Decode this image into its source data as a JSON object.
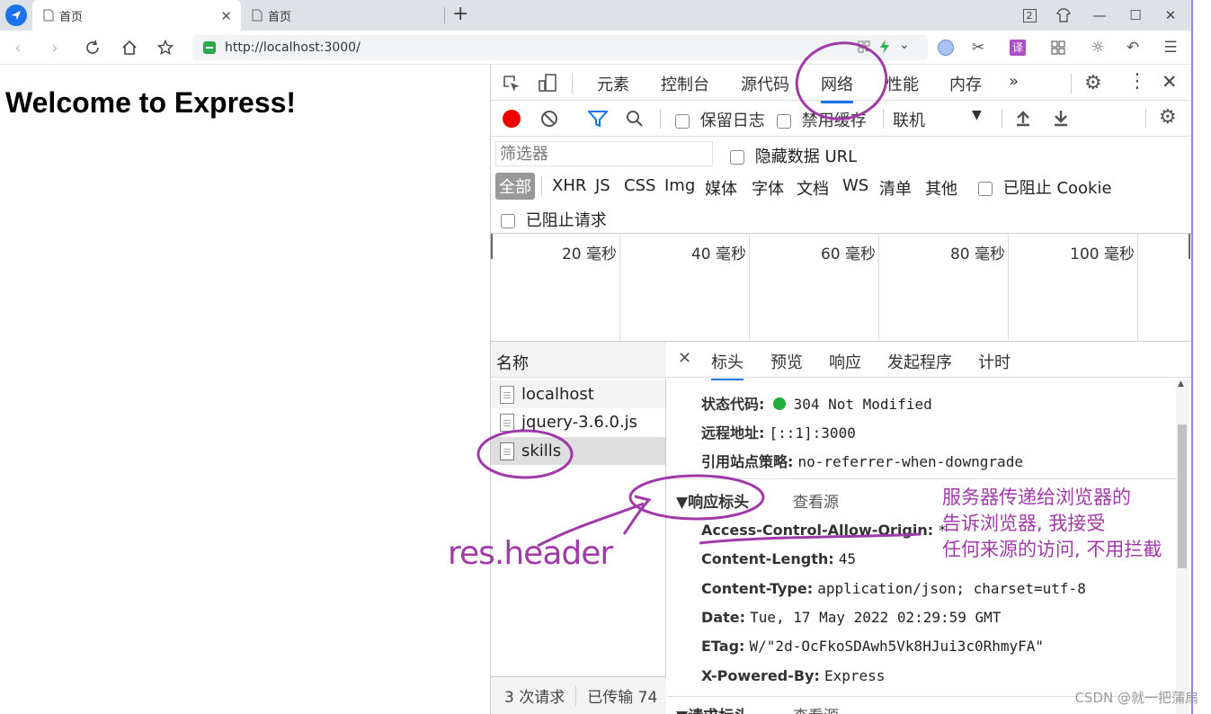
{
  "browser": {
    "tabs": [
      {
        "title": "首页",
        "active": true
      },
      {
        "title": "首页",
        "active": false
      }
    ],
    "window_badge": "2",
    "url": "http://localhost:3000/"
  },
  "page": {
    "heading": "Welcome to Express!"
  },
  "devtools": {
    "tabs": [
      "元素",
      "控制台",
      "源代码",
      "网络",
      "性能",
      "内存"
    ],
    "active_tab": "网络",
    "more_label": "»",
    "toolbar": {
      "preserve_log": "保留日志",
      "disable_cache": "禁用缓存",
      "throttle": "联机"
    },
    "filter": {
      "placeholder": "筛选器",
      "hide_data_url": "隐藏数据 URL"
    },
    "types": [
      "全部",
      "XHR",
      "JS",
      "CSS",
      "Img",
      "媒体",
      "字体",
      "文档",
      "WS",
      "清单",
      "其他"
    ],
    "blocked_cookie": "已阻止 Cookie",
    "blocked_requests": "已阻止请求",
    "timeline_labels": [
      "20 毫秒",
      "40 毫秒",
      "60 毫秒",
      "80 毫秒",
      "100 毫秒"
    ],
    "name_header": "名称",
    "requests": [
      "localhost",
      "jquery-3.6.0.js",
      "skills"
    ],
    "footer": {
      "requests": "3 次请求",
      "transferred": "已传输 74"
    },
    "detail_tabs": [
      "标头",
      "预览",
      "响应",
      "发起程序",
      "计时"
    ],
    "general": [
      {
        "key": "状态代码:",
        "value": "304 Not Modified"
      },
      {
        "key": "远程地址:",
        "value": "[::1]:3000"
      },
      {
        "key": "引用站点策略:",
        "value": "no-referrer-when-downgrade"
      }
    ],
    "response_headers_title": "▼响应标头",
    "view_source": "查看源",
    "response_headers": [
      {
        "key": "Access-Control-Allow-Origin:",
        "value": "*"
      },
      {
        "key": "Content-Length:",
        "value": "45"
      },
      {
        "key": "Content-Type:",
        "value": "application/json; charset=utf-8"
      },
      {
        "key": "Date:",
        "value": "Tue, 17 May 2022 02:29:59 GMT"
      },
      {
        "key": "ETag:",
        "value": "W/\"2d-OcFkoSDAwh5Vk8HJui3c0RhmyFA\""
      },
      {
        "key": "X-Powered-By:",
        "value": "Express"
      }
    ],
    "request_headers_title": "▼请求标头",
    "status_color": "#1fae3d",
    "accent_color": "#1a73e8"
  },
  "annotations": {
    "res_header": "res.header",
    "note_lines": [
      "服务器传递给浏览器的",
      "告诉浏览器, 我接受",
      "任何来源的访问, 不用拦截"
    ],
    "color": "#a03aa8"
  },
  "watermark": "CSDN @就一把蒲扇"
}
